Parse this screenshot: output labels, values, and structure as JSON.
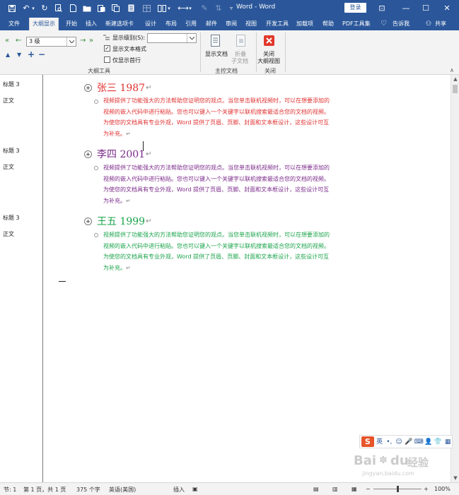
{
  "window": {
    "title": "Word  -  Word",
    "login_label": "登录",
    "controls": {
      "ribbon_display": "⊡",
      "minimize": "—",
      "maximize": "☐",
      "close": "✕"
    }
  },
  "tabs": [
    {
      "label": "文件",
      "active": false
    },
    {
      "label": "大纲显示",
      "active": true
    },
    {
      "label": "开始",
      "active": false
    },
    {
      "label": "插入",
      "active": false
    },
    {
      "label": "新建选项卡",
      "active": false
    },
    {
      "label": "设计",
      "active": false
    },
    {
      "label": "布局",
      "active": false
    },
    {
      "label": "引用",
      "active": false
    },
    {
      "label": "邮件",
      "active": false
    },
    {
      "label": "审阅",
      "active": false
    },
    {
      "label": "视图",
      "active": false
    },
    {
      "label": "开发工具",
      "active": false
    },
    {
      "label": "加载项",
      "active": false
    },
    {
      "label": "帮助",
      "active": false
    },
    {
      "label": "PDF工具集",
      "active": false
    }
  ],
  "tell_me": "告诉我",
  "share": "共享",
  "ribbon": {
    "outline_tools": {
      "level_value": "3 级",
      "show_level_label": "显示级别(S):",
      "show_text_format_label": "显示文本格式",
      "show_text_format_checked": true,
      "show_first_line_label": "仅显示首行",
      "show_first_line_checked": false,
      "group_label": "大纲工具"
    },
    "master_document": {
      "show_document_label": "显示文档",
      "collapse_subdocs_line1": "折叠",
      "collapse_subdocs_line2": "子文档",
      "group_label": "主控文档"
    },
    "close": {
      "close_view_line1": "关闭",
      "close_view_line2": "大纲视图",
      "group_label": "关闭"
    }
  },
  "document": {
    "sections": [
      {
        "style_heading": "标题 3",
        "style_body": "正文",
        "heading": "张三 1987",
        "heading_mark": "↵",
        "color": "#e03131",
        "body": "视频提供了功能强大的方法帮助您证明您的观点。当您单击联机视频时，可以在想要添加的视频的嵌入代码中进行粘贴。您也可以键入一个关键字以联机搜索最适合您的文档的视频。为使您的文档具有专业外观，Word 提供了页眉、页脚、封面和文本框设计，这些设计可互为补充。",
        "body_mark": "↵"
      },
      {
        "style_heading": "标题 3",
        "style_body": "正文",
        "heading": "李四 2001",
        "heading_mark": "↵",
        "color": "#7b2a8a",
        "body": "视频提供了功能强大的方法帮助您证明您的观点。当您单击联机视频时，可以在想要添加的视频的嵌入代码中进行粘贴。您也可以键入一个关键字以联机搜索最适合您的文档的视频。为使您的文档具有专业外观，Word 提供了页眉、页脚、封面和文本框设计，这些设计可互为补充。",
        "body_mark": "↵"
      },
      {
        "style_heading": "标题 3",
        "style_body": "正文",
        "heading": "王五 1999",
        "heading_mark": "↵",
        "color": "#1aa34a",
        "body": "视频提供了功能强大的方法帮助您证明您的观点。当您单击联机视频时，可以在想要添加的视频的嵌入代码中进行粘贴。您也可以键入一个关键字以联机搜索最适合您的文档的视频。为使您的文档具有专业外观，Word 提供了页眉、页脚、封面和文本框设计，这些设计可互为补充。",
        "body_mark": "↵"
      }
    ]
  },
  "ime": {
    "lang": "英",
    "punct": "•,"
  },
  "watermark": {
    "brand": "Bai",
    "brand2": "du",
    "cn": "经验",
    "url": "jingyan.baidu.com"
  },
  "status": {
    "section": "节: 1",
    "page": "第 1 页，共 1 页",
    "words": "375 个字",
    "language": "英语(美国)",
    "mode": "插入",
    "zoom_minus": "−",
    "zoom_plus": "+",
    "zoom": "100%"
  }
}
